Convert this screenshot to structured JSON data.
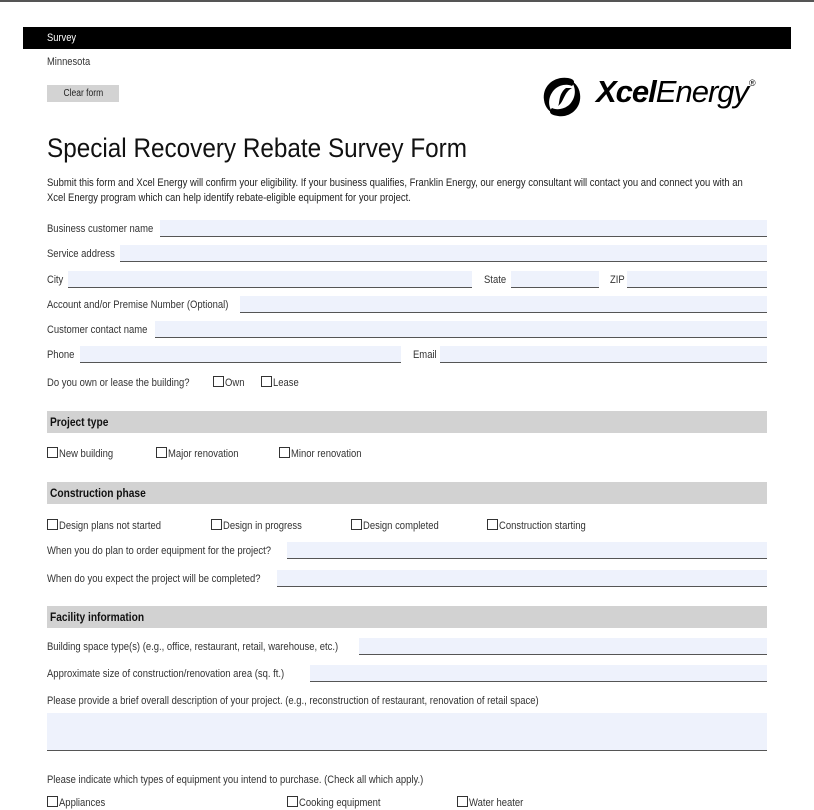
{
  "header": {
    "bar_title": "Survey",
    "state": "Minnesota",
    "clear_button": "Clear form",
    "logo_bold": "Xcel",
    "logo_light": "Energy",
    "logo_mark": "®"
  },
  "title": "Special Recovery Rebate Survey Form",
  "intro": "Submit this form and Xcel Energy will confirm your eligibility. If your business qualifies, Franklin Energy, our energy consultant will contact you and connect you with an Xcel Energy program which can help identify rebate-eligible equipment for your project.",
  "fields": {
    "business_name": {
      "label": "Business customer name",
      "value": ""
    },
    "service_address": {
      "label": "Service address",
      "value": ""
    },
    "city": {
      "label": "City",
      "value": ""
    },
    "state": {
      "label": "State",
      "value": ""
    },
    "zip": {
      "label": "ZIP",
      "value": ""
    },
    "account": {
      "label": "Account and/or Premise Number (Optional)",
      "value": ""
    },
    "contact_name": {
      "label": "Customer contact name",
      "value": ""
    },
    "phone": {
      "label": "Phone",
      "value": ""
    },
    "email": {
      "label": "Email",
      "value": ""
    }
  },
  "own_lease": {
    "question": "Do you own or lease the building?",
    "options": [
      "Own",
      "Lease"
    ]
  },
  "project_type": {
    "heading": "Project type",
    "options": [
      "New building",
      "Major renovation",
      "Minor renovation"
    ]
  },
  "construction_phase": {
    "heading": "Construction phase",
    "options": [
      "Design plans not started",
      "Design in progress",
      "Design completed",
      "Construction starting"
    ],
    "order_question": "When you do plan to order equipment for the project?",
    "complete_question": "When do you expect the project will be completed?"
  },
  "facility": {
    "heading": "Facility information",
    "space_type_label": "Building space type(s) (e.g., office, restaurant, retail, warehouse, etc.)",
    "size_label": "Approximate size of construction/renovation area (sq. ft.)",
    "description_label": "Please provide a brief overall description of your project. (e.g., reconstruction of restaurant, renovation of retail space)",
    "equipment_question": "Please indicate which types of equipment you intend to purchase. (Check all which apply.)",
    "equipment_options": [
      "Appliances",
      "Cooking equipment",
      "Water heater"
    ]
  }
}
